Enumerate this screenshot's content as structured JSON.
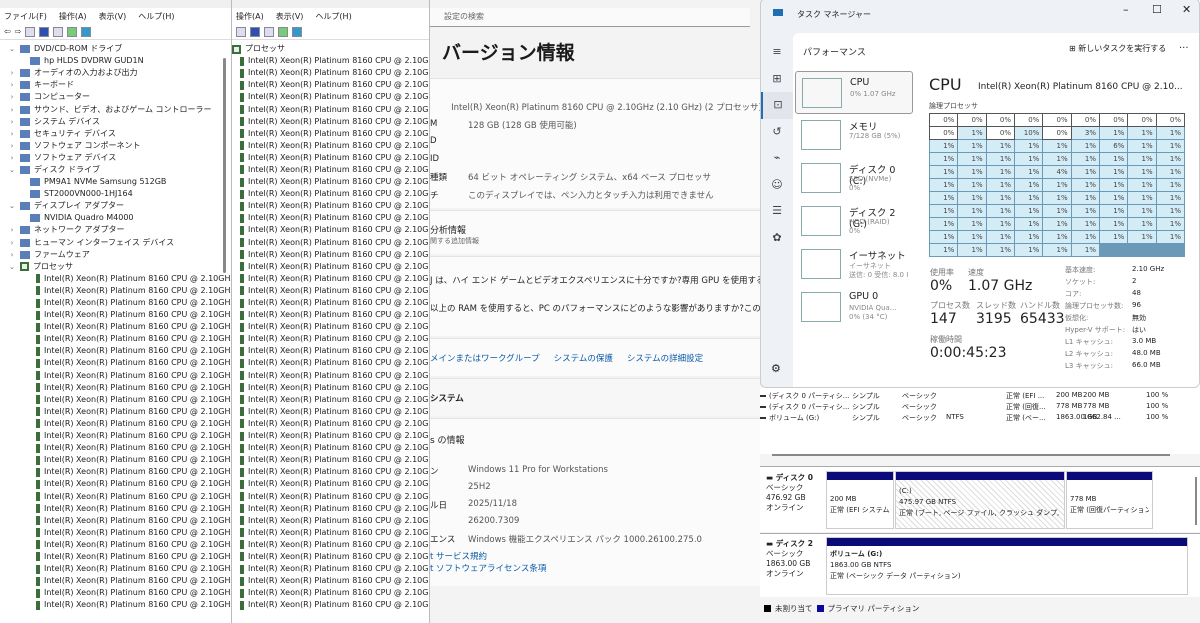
{
  "devmgr1": {
    "menu": [
      "ファイル(F)",
      "操作(A)",
      "表示(V)",
      "ヘルプ(H)"
    ],
    "tree": [
      {
        "label": "DVD/CD-ROM ドライブ",
        "indent": 1,
        "exp": "v"
      },
      {
        "label": "hp HLDS DVDRW  GUD1N",
        "indent": 2,
        "exp": ""
      },
      {
        "label": "オーディオの入力および出力",
        "indent": 1,
        "exp": ">"
      },
      {
        "label": "キーボード",
        "indent": 1,
        "exp": ">"
      },
      {
        "label": "コンピューター",
        "indent": 1,
        "exp": ">"
      },
      {
        "label": "サウンド、ビデオ、およびゲーム コントローラー",
        "indent": 1,
        "exp": ">"
      },
      {
        "label": "システム デバイス",
        "indent": 1,
        "exp": ">"
      },
      {
        "label": "セキュリティ デバイス",
        "indent": 1,
        "exp": ">"
      },
      {
        "label": "ソフトウェア コンポーネント",
        "indent": 1,
        "exp": ">"
      },
      {
        "label": "ソフトウェア デバイス",
        "indent": 1,
        "exp": ">"
      },
      {
        "label": "ディスク ドライブ",
        "indent": 1,
        "exp": "v"
      },
      {
        "label": "PM9A1 NVMe Samsung 512GB",
        "indent": 2,
        "exp": ""
      },
      {
        "label": "ST2000VN000-1HJ164",
        "indent": 2,
        "exp": ""
      },
      {
        "label": "ディスプレイ アダプター",
        "indent": 1,
        "exp": "v"
      },
      {
        "label": "NVIDIA Quadro M4000",
        "indent": 2,
        "exp": ""
      },
      {
        "label": "ネットワーク アダプター",
        "indent": 1,
        "exp": ">"
      },
      {
        "label": "ヒューマン インターフェイス デバイス",
        "indent": 1,
        "exp": ">"
      },
      {
        "label": "ファームウェア",
        "indent": 1,
        "exp": ">"
      },
      {
        "label": "プロセッサ",
        "indent": 1,
        "exp": "v"
      }
    ],
    "processor_name": "Intel(R) Xeon(R) Platinum 8160 CPU @ 2.10GHz",
    "processor_rows_visible": 28
  },
  "devmgr2": {
    "menu": [
      "操作(A)",
      "表示(V)",
      "ヘルプ(H)"
    ],
    "category": "プロセッサ",
    "processor_name": "Intel(R) Xeon(R) Platinum 8160 CPU @ 2.10GHz",
    "processor_rows_visible": 46
  },
  "settings": {
    "search_placeholder": "設定の検索",
    "title": "バージョン情報",
    "specs": [
      {
        "k": "",
        "v": "Intel(R) Xeon(R) Platinum 8160 CPU @ 2.10GHz (2.10 GHz) (2 プロセッサ)"
      },
      {
        "k": "M",
        "v": "128 GB (128 GB 使用可能)"
      },
      {
        "k": "D",
        "v": ""
      },
      {
        "k": "ID",
        "v": ""
      },
      {
        "k": "種類",
        "v": "64 ビット オペレーティング システム、x64 ベース プロセッサ"
      },
      {
        "k": "チ",
        "v": "このディスプレイでは、ペン入力とタッチ入力は利用できません"
      }
    ],
    "analysis_title": "分析情報",
    "analysis_sub": "関する追加情報",
    "q1": "J は、ハイ エンド ゲームとビデオエクスペリエンスに十分ですか?専用 GPU を使用すると、エク",
    "q2": "以上の RAM を使用すると、PC のパフォーマンスにどのような影響がありますか?この RAM 容",
    "links": [
      "メインまたはワークグループ",
      "システムの保護",
      "システムの詳細設定"
    ],
    "system_header": "システム",
    "win_header": "s の情報",
    "win_specs": [
      {
        "k": "ン",
        "v": "Windows 11 Pro for Workstations"
      },
      {
        "k": "",
        "v": "25H2"
      },
      {
        "k": "ル日",
        "v": "2025/11/18"
      },
      {
        "k": "",
        "v": "26200.7309"
      },
      {
        "k": "エンス",
        "v": "Windows 機能エクスペリエンス パック 1000.26100.275.0"
      }
    ],
    "win_links": [
      "t サービス規約",
      "t ソフトウェアライセンス条項"
    ]
  },
  "taskmgr": {
    "title": "タスク マネージャー",
    "section": "パフォーマンス",
    "run_task": "新しいタスクを実行する",
    "more": "···",
    "resources": [
      {
        "name": "CPU",
        "sub1": "0%  1.07 GHz",
        "sub2": ""
      },
      {
        "name": "メモリ",
        "sub1": "7/128 GB (5%)",
        "sub2": ""
      },
      {
        "name": "ディスク 0 (C:)",
        "sub1": "SSD (NVMe)",
        "sub2": "0%"
      },
      {
        "name": "ディスク 2 (G:)",
        "sub1": "HDD (RAID)",
        "sub2": "0%"
      },
      {
        "name": "イーサネット",
        "sub1": "イーサネット",
        "sub2": "送信: 0 受信: 8.0 I"
      },
      {
        "name": "GPU 0",
        "sub1": "NVIDIA Qua...",
        "sub2": "0% (34 °C)"
      }
    ],
    "cpu_title": "CPU",
    "cpu_model": "Intel(R) Xeon(R) Platinum 8160 CPU @ 2.10...",
    "logical_label": "論理プロセッサ",
    "core_usage": [
      0,
      0,
      0,
      0,
      0,
      0,
      0,
      0,
      0,
      0,
      1,
      0,
      10,
      0,
      3,
      1,
      1,
      1,
      1,
      1,
      1,
      1,
      1,
      1,
      6,
      1,
      1,
      1,
      1,
      1,
      1,
      1,
      1,
      1,
      1,
      1,
      1,
      1,
      1,
      1,
      4,
      1,
      1,
      1,
      1,
      1,
      1,
      1,
      1,
      1,
      1,
      1,
      1,
      1,
      1,
      1,
      1,
      1,
      1,
      1,
      1,
      1,
      1,
      1,
      1,
      1,
      1,
      1,
      1,
      1,
      1,
      1,
      1,
      1,
      1,
      1,
      1,
      1,
      1,
      1,
      1,
      1,
      1,
      1,
      1,
      1,
      1,
      1,
      1,
      1,
      1,
      1,
      1,
      1,
      1,
      1
    ],
    "usage_label": "使用率",
    "usage": "0%",
    "speed_label": "速度",
    "speed": "1.07 GHz",
    "proc_label": "プロセス数",
    "proc": "147",
    "thread_label": "スレッド数",
    "thread": "3195",
    "handle_label": "ハンドル数",
    "handle": "65433",
    "uptime_label": "稼働時間",
    "uptime": "0:00:45:23",
    "details": [
      {
        "k": "基本速度:",
        "v": "2.10 GHz"
      },
      {
        "k": "ソケット:",
        "v": "2"
      },
      {
        "k": "コア:",
        "v": "48"
      },
      {
        "k": "論理プロセッサ数:",
        "v": "96"
      },
      {
        "k": "仮想化:",
        "v": "無効"
      },
      {
        "k": "Hyper-V サポート:",
        "v": "はい"
      },
      {
        "k": "L1 キャッシュ:",
        "v": "3.0 MB"
      },
      {
        "k": "L2 キャッシュ:",
        "v": "48.0 MB"
      },
      {
        "k": "L3 キャッシュ:",
        "v": "66.0 MB"
      }
    ]
  },
  "diskmgmt": {
    "volumes": [
      [
        "(ディスク 0 パーティシ...",
        "シンプル",
        "ベーシック",
        "",
        "正常 (EFI ...",
        "200 MB",
        "200 MB",
        "100 %"
      ],
      [
        "(ディスク 0 パーティシ...",
        "シンプル",
        "ベーシック",
        "",
        "正常 (回復...",
        "778 MB",
        "778 MB",
        "100 %"
      ],
      [
        "ボリューム (G:)",
        "シンプル",
        "ベーシック",
        "NTFS",
        "正常 (ベー...",
        "1863.00 GB",
        "1862.84 ...",
        "100 %"
      ]
    ],
    "disk0": {
      "name": "ディスク 0",
      "type": "ベーシック",
      "size": "476.92 GB",
      "status": "オンライン",
      "p1": {
        "size": "200 MB",
        "status": "正常 (EFI システム"
      },
      "p2": {
        "label": "(C:)",
        "size": "475.97 GB NTFS",
        "status": "正常 (ブート, ページ ファイル, クラッシュ ダンプ, ベーシ"
      },
      "p3": {
        "size": "778 MB",
        "status": "正常 (回復パーティション"
      }
    },
    "disk2": {
      "name": "ディスク 2",
      "type": "ベーシック",
      "size": "1863.00 GB",
      "status": "オンライン",
      "p1": {
        "label": "ボリューム (G:)",
        "size": "1863.00 GB NTFS",
        "status": "正常 (ベーシック データ パーティション)"
      }
    },
    "legend": [
      "未割り当て",
      "プライマリ パーティション"
    ]
  }
}
